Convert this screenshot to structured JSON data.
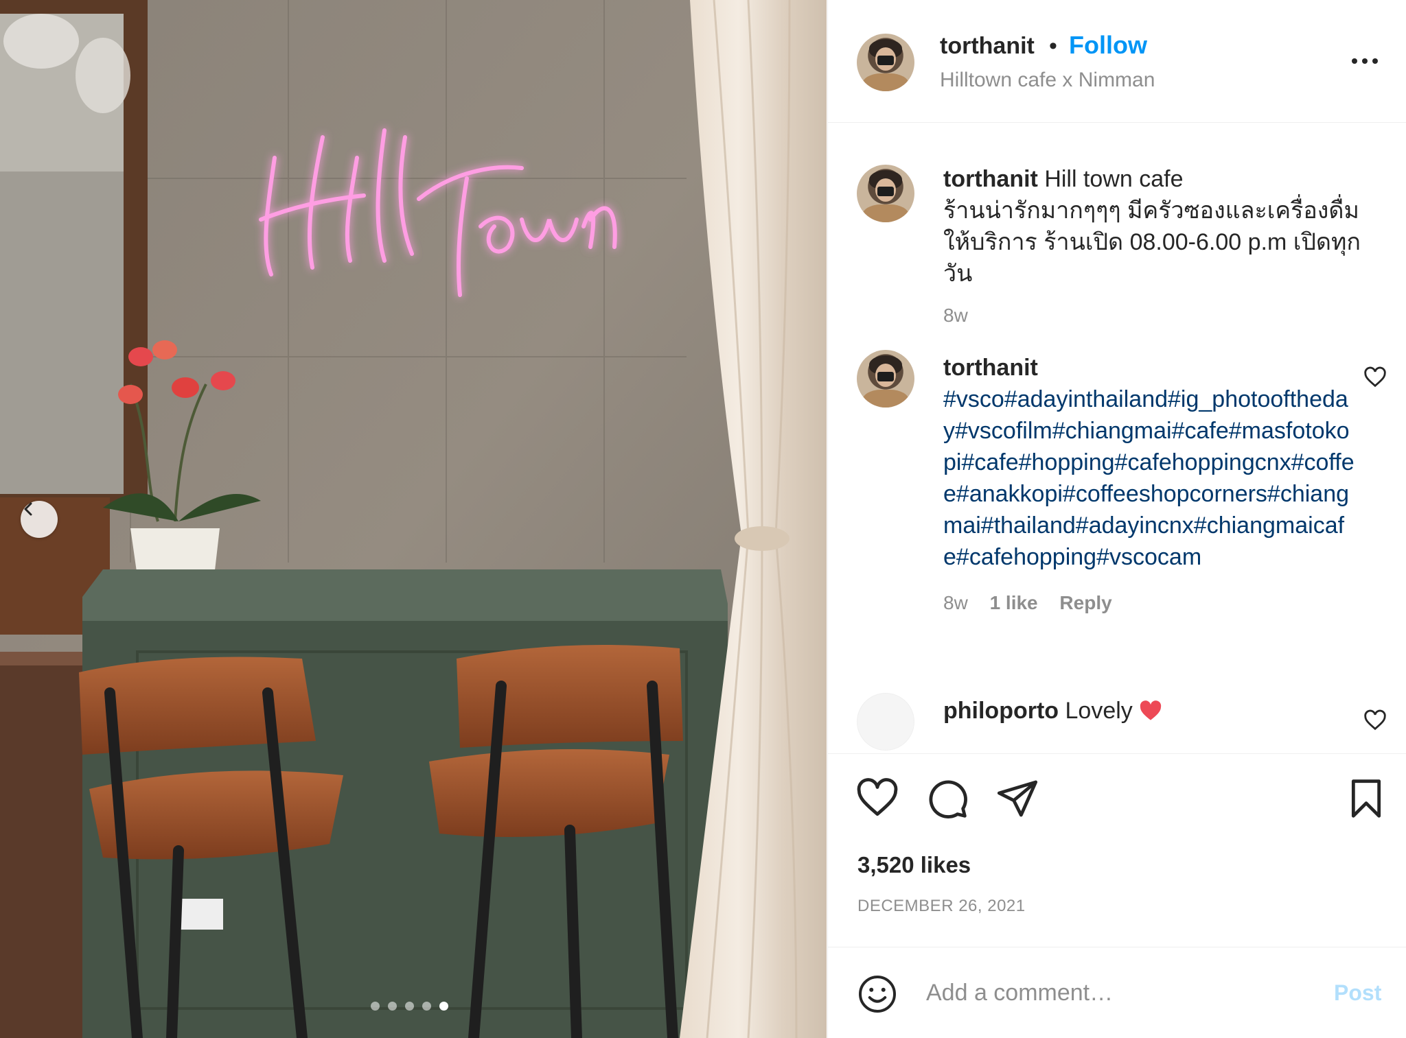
{
  "post": {
    "image_alt": "Hill Town neon sign above a green counter with two wooden stools",
    "neon_text": "Hill Town",
    "carousel": {
      "total_slides": 5,
      "active_slide": 5
    }
  },
  "header": {
    "username": "torthanit",
    "separator": "•",
    "follow_label": "Follow",
    "location": "Hilltown cafe x Nimman"
  },
  "caption": {
    "username": "torthanit",
    "text_line1": "Hill town cafe",
    "text_thai": "ร้านน่ารักมากๆๆๆ มีครัวซองและเครื่องดื่มให้บริการ ร้านเปิด 08.00-6.00 p.m เปิดทุกวัน",
    "age": "8w"
  },
  "comments": [
    {
      "username": "torthanit",
      "text": "#vsco#adayinthailand#ig_photooftheday#vscofilm#chiangmai#cafe#masfotokopi#cafe#hopping#cafehoppingcnx#coffee#anakkopi#coffeeshopcorners#chiangmai#thailand#adayincnx#chiangmaicafe#cafehopping#vscocam",
      "age": "8w",
      "likes": "1 like",
      "reply_label": "Reply"
    },
    {
      "username": "philoporto",
      "text": "Lovely"
    }
  ],
  "footer": {
    "likes": "3,520 likes",
    "date": "DECEMBER 26, 2021",
    "comment_placeholder": "Add a comment…",
    "post_label": "Post"
  },
  "colors": {
    "link_blue": "#0095f6",
    "hashtag_blue": "#00376b",
    "heart_red": "#ed4956",
    "muted": "#8e8e8e"
  }
}
